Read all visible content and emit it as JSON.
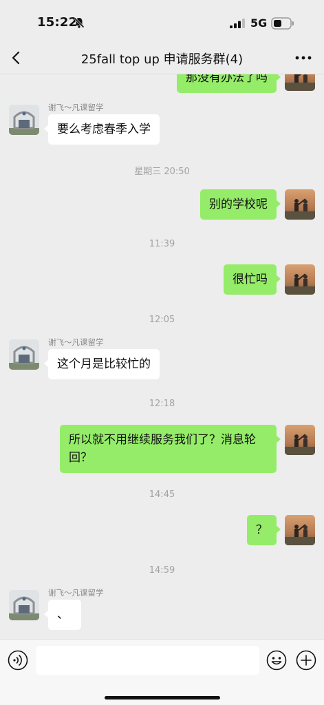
{
  "status_bar": {
    "time": "15:22",
    "network": "5G"
  },
  "header": {
    "title": "25fall top up 申请服务群(4)"
  },
  "messages": [
    {
      "text": "那没有办法了吗"
    },
    {
      "sender": "谢飞～凡课留学",
      "text": "要么考虑春季入学"
    },
    {
      "time": "星期三 20:50"
    },
    {
      "text": "别的学校呢"
    },
    {
      "time": "11:39"
    },
    {
      "text": "很忙吗"
    },
    {
      "time": "12:05"
    },
    {
      "sender": "谢飞～凡课留学",
      "text": "这个月是比较忙的"
    },
    {
      "time": "12:18"
    },
    {
      "text_line1": "所以就不用继续服务我们了？消息轮",
      "text_line2": "回？"
    },
    {
      "time": "14:45"
    },
    {
      "text": "？"
    },
    {
      "time": "14:59"
    },
    {
      "sender": "谢飞～凡课留学",
      "text": "、"
    }
  ],
  "input_bar": {
    "placeholder": ""
  },
  "colors": {
    "background": "#ededed",
    "outgoing_bubble": "#95ec69",
    "incoming_bubble": "#ffffff"
  },
  "icons": [
    "bell-mute-icon",
    "signal-icon",
    "battery-icon",
    "back-icon",
    "more-icon",
    "voice-icon",
    "emoji-icon",
    "plus-icon"
  ]
}
